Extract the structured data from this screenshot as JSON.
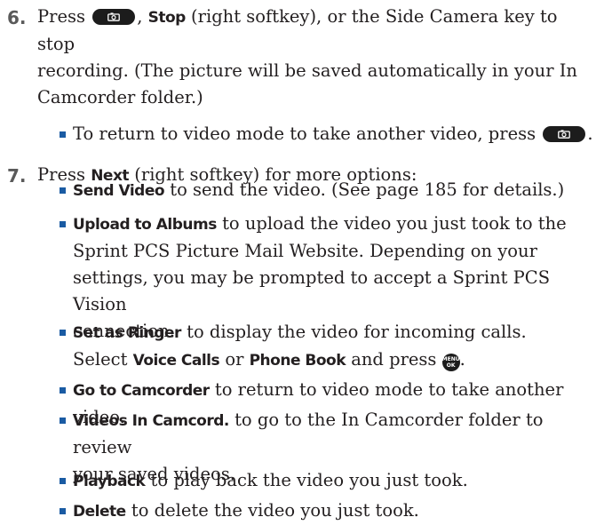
{
  "step6": {
    "number": "6.",
    "press": "Press",
    "comma": ",",
    "stop_label": "Stop",
    "line1_rest": "(right softkey), or the Side Camera key to stop",
    "line2": "recording. (The picture will be saved automatically in your In",
    "line3": "Camcorder folder.)",
    "bullet_text": "To return to video mode to take another video, press",
    "bullet_end": "."
  },
  "step7": {
    "number": "7.",
    "press": "Press",
    "next_label": "Next",
    "rest": "(right softkey) for more options:",
    "options": [
      {
        "label": "Send Video",
        "lines": [
          "to send the video. (See page 185 for details.)"
        ]
      },
      {
        "label": "Upload to Albums",
        "lines": [
          "to upload the video you just took to the",
          "Sprint PCS Picture Mail Website. Depending on your",
          "settings, you may be prompted to accept a Sprint PCS Vision",
          "connection."
        ]
      },
      {
        "label": "Set as Ringer",
        "lines": [
          "to display the video for incoming calls."
        ]
      },
      {
        "label": "Go to Camcorder",
        "lines": [
          "to return to video mode to take another video."
        ]
      },
      {
        "label": "Videos In Camcord.",
        "lines": [
          "to go to the In Camcorder folder to review",
          "your saved videos."
        ]
      },
      {
        "label": "Playback",
        "lines": [
          "to play back the video you just took."
        ]
      },
      {
        "label": "Delete",
        "lines": [
          "to delete the video you just took."
        ]
      }
    ],
    "ringer_line2": {
      "select": "Select",
      "voice_calls": "Voice Calls",
      "or": "or",
      "phone_book": "Phone Book",
      "and_press": "and press",
      "end": "."
    }
  },
  "icons": {
    "camera_key": "camera-key-icon",
    "menu_ok_key": "menu-ok-key-icon",
    "menu_key_text": [
      "MENU",
      "OK"
    ]
  }
}
